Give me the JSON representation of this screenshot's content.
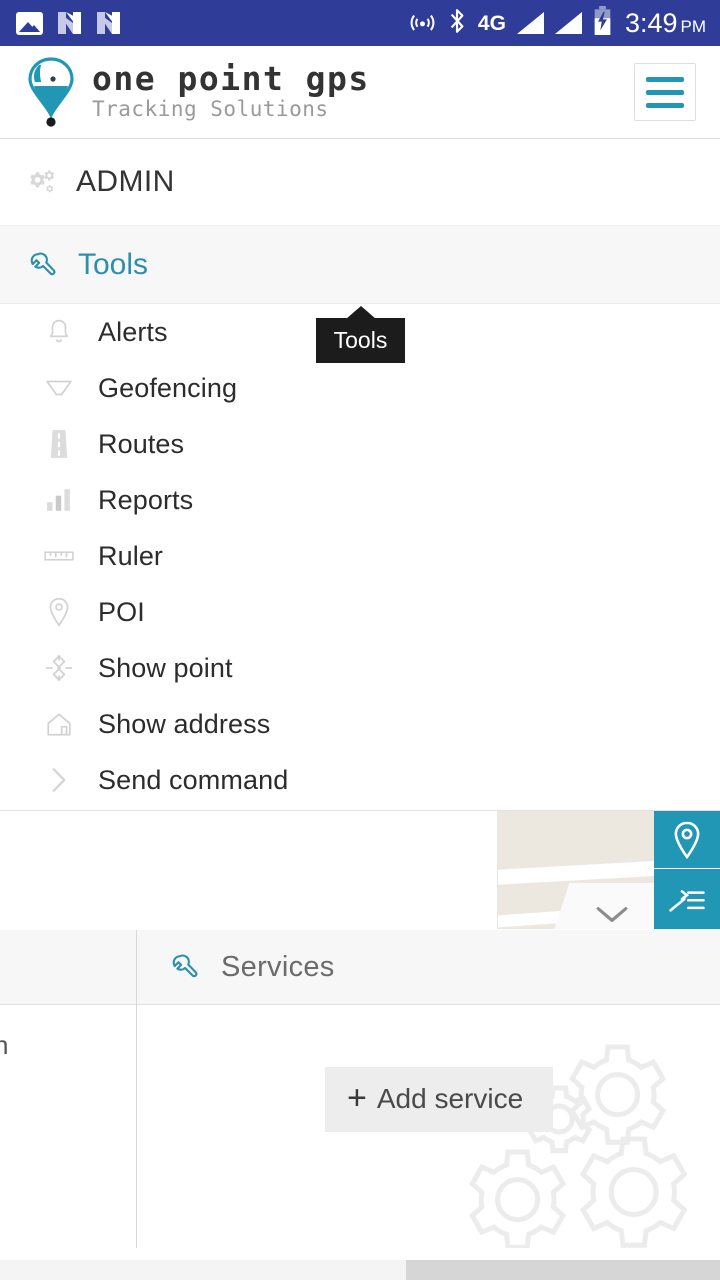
{
  "statusbar": {
    "left_icons": [
      "photo-icon",
      "android-n-icon",
      "android-n-icon"
    ],
    "right_icons": [
      "cast-icon",
      "bluetooth-icon"
    ],
    "network_type": "4G",
    "signal_icons": [
      "signal-bar-icon",
      "signal-bar-icon"
    ],
    "battery_icon": "battery-charging-icon",
    "time": "3:49",
    "time_period": "PM",
    "background_color": "#2f3d99"
  },
  "appbar": {
    "logo_icon": "map-pin-logo-icon",
    "brand_name": "one point gps",
    "brand_tagline": "Tracking Solutions",
    "menu_button_icon": "hamburger-menu-icon",
    "accent_color": "#2196b5"
  },
  "menu": {
    "section_label": "ADMIN",
    "section_icon": "gears-icon",
    "active_item": {
      "label": "Tools",
      "icon": "wrench-icon",
      "color": "#2b8fae"
    },
    "items": [
      {
        "label": "Alerts",
        "icon": "bell-icon"
      },
      {
        "label": "Geofencing",
        "icon": "geofence-icon"
      },
      {
        "label": "Routes",
        "icon": "road-icon"
      },
      {
        "label": "Reports",
        "icon": "bar-chart-icon"
      },
      {
        "label": "Ruler",
        "icon": "ruler-icon"
      },
      {
        "label": "POI",
        "icon": "map-marker-icon"
      },
      {
        "label": "Show point",
        "icon": "crosshair-icon"
      },
      {
        "label": "Show address",
        "icon": "home-icon"
      },
      {
        "label": "Send command",
        "icon": "chevron-right-icon"
      }
    ]
  },
  "tooltip": {
    "text": "Tools",
    "background_color": "#1c1c1c"
  },
  "map": {
    "pin_button_icon": "map-marker-icon",
    "layers_button_icon": "layers-list-icon",
    "collapse_button_icon": "chevron-down-icon",
    "button_color": "#2196b5",
    "terrain_color": "#ece8e0"
  },
  "services": {
    "title": "Services",
    "title_icon": "wrench-icon",
    "add_button_label": "Add service",
    "add_button_icon": "plus-icon",
    "background_icon": "gears-watermark-icon"
  },
  "left_panel": {
    "clipped_text": "n"
  },
  "scrollbar": {
    "orientation": "horizontal"
  }
}
